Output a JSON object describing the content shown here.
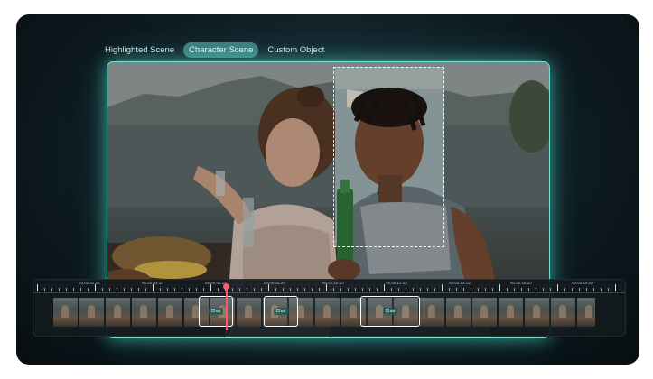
{
  "tabs": {
    "items": [
      {
        "label": "Highlighted Scene",
        "active": false
      },
      {
        "label": "Character Scene",
        "active": true
      },
      {
        "label": "Custom Object",
        "active": false
      }
    ]
  },
  "timeline": {
    "timestamps": [
      "00:00:02:03",
      "00:00:04:10",
      "00:00:06:20",
      "00:00:08:20",
      "00:00:10:10",
      "00:00:12:03",
      "00:00:14:12",
      "00:00:16:20",
      "00:00:18:00"
    ],
    "clip_labels": [
      "Char",
      "Char",
      "Char"
    ]
  },
  "colors": {
    "accent": "#6fe3d3",
    "active_tab": "#3f7f7c",
    "playhead": "#ff5a6a"
  }
}
